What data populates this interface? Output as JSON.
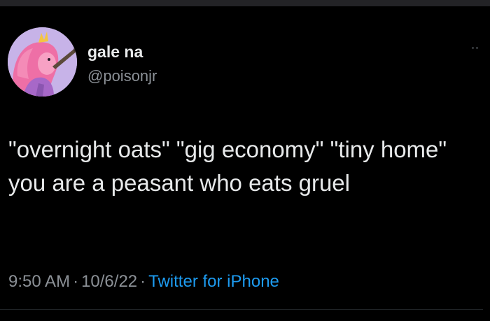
{
  "tweet": {
    "author": {
      "display_name": "gale na",
      "handle": "@poisonjr"
    },
    "text": "\"overnight oats\" \"gig economy\" \"tiny home\" you are a peasant who eats gruel",
    "time": "9:50 AM",
    "date": "10/6/22",
    "separator": "·",
    "source": "Twitter for iPhone"
  },
  "colors": {
    "background": "#000000",
    "text_primary": "#e7e9ea",
    "text_secondary": "#8b9096",
    "link": "#1d9bf0"
  },
  "icons": {
    "more": "more-horizontal-icon"
  }
}
